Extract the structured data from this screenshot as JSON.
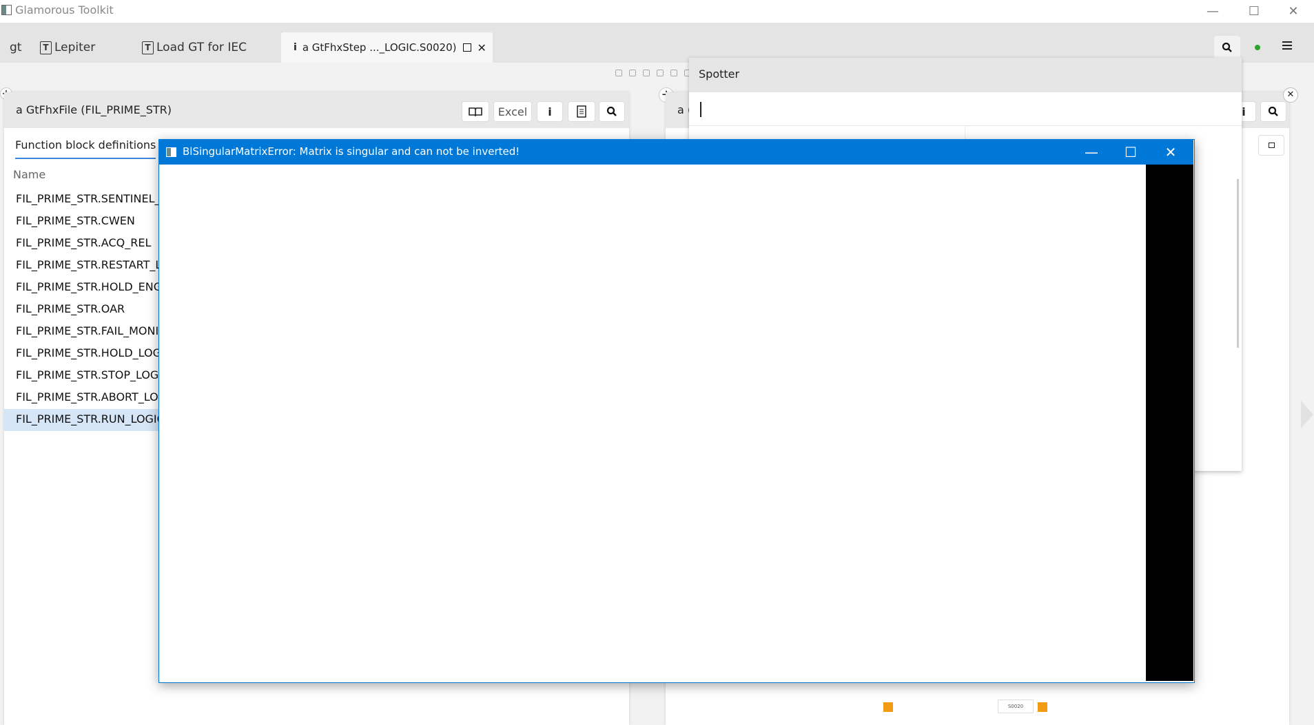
{
  "window": {
    "title": "Glamorous Toolkit",
    "minimize": "—",
    "maximize": "☐",
    "close": "✕"
  },
  "tabs": [
    {
      "label": "gt"
    },
    {
      "label": "Lepiter"
    },
    {
      "label": "Load  GT  for IEC"
    },
    {
      "label": "a GtFhxStep ..._LOGIC.S0020)",
      "icon": "i",
      "active": true
    }
  ],
  "toolbar": {
    "search_icon": "search-icon",
    "status_color": "#2aa52a",
    "menu_icon": "hamburger-menu-icon"
  },
  "left_panel": {
    "title": "a GtFhxFile (FIL_PRIME_STR)",
    "excel_label": "Excel",
    "info_label": "i",
    "tab_label": "Function block definitions",
    "column_header": "Name",
    "rows": [
      "FIL_PRIME_STR.SENTINEL_E",
      "FIL_PRIME_STR.CWEN",
      "FIL_PRIME_STR.ACQ_REL",
      "FIL_PRIME_STR.RESTART_LC",
      "FIL_PRIME_STR.HOLD_ENG",
      "FIL_PRIME_STR.OAR",
      "FIL_PRIME_STR.FAIL_MONIT",
      "FIL_PRIME_STR.HOLD_LOGI(",
      "FIL_PRIME_STR.STOP_LOGI(",
      "FIL_PRIME_STR.ABORT_LOG",
      "FIL_PRIME_STR.RUN_LOGIC"
    ],
    "selected_index": 10
  },
  "right_panel": {
    "title": "a (",
    "info_label": "i",
    "node_label": "S0020"
  },
  "spotter": {
    "title": "Spotter",
    "input_value": ""
  },
  "dialog": {
    "title": "BlSingularMatrixError: Matrix is singular and can not be inverted!",
    "minimize": "—",
    "maximize": "☐",
    "close": "✕"
  },
  "accent_colors": {
    "dialog_blue": "#0078d7",
    "selection": "#d6e6f7",
    "orange": "#f29a12"
  }
}
